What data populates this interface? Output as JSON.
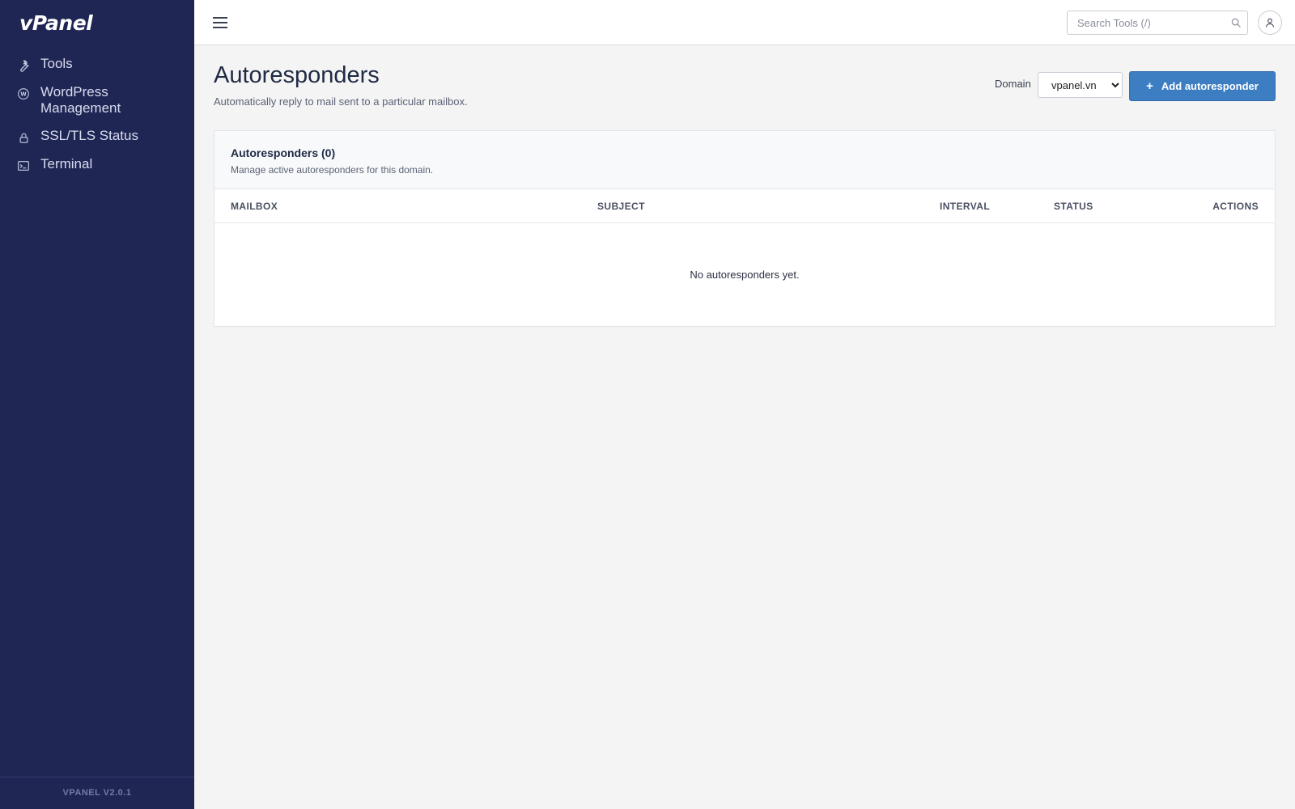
{
  "sidebar": {
    "logo": "vPanel",
    "items": [
      {
        "label": "Tools",
        "icon": "wrench-icon"
      },
      {
        "label": "WordPress Management",
        "icon": "wordpress-icon"
      },
      {
        "label": "SSL/TLS Status",
        "icon": "lock-icon"
      },
      {
        "label": "Terminal",
        "icon": "terminal-icon"
      }
    ],
    "version": "VPANEL V2.0.1"
  },
  "topbar": {
    "search_placeholder": "Search Tools (/)"
  },
  "page": {
    "title": "Autoresponders",
    "subtitle": "Automatically reply to mail sent to a particular mailbox.",
    "domain_label": "Domain",
    "domain_selected": "vpanel.vn",
    "add_button": "Add autoresponder"
  },
  "table": {
    "title": "Autoresponders (0)",
    "subtitle": "Manage active autoresponders for this domain.",
    "columns": [
      "MAILBOX",
      "SUBJECT",
      "INTERVAL",
      "STATUS",
      "ACTIONS"
    ],
    "empty_text": "No autoresponders yet."
  },
  "colors": {
    "sidebar_bg": "#202654",
    "primary_button": "#3d7ec3",
    "page_bg": "#f4f4f4"
  }
}
